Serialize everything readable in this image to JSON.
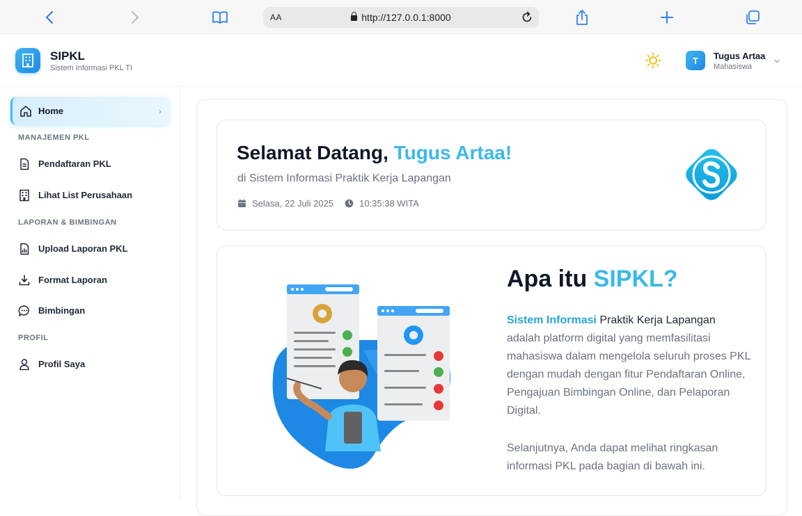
{
  "browser": {
    "aa_label": "AA",
    "url": "http://127.0.0.1:8000"
  },
  "header": {
    "brand": "SIPKL",
    "brand_subtitle": "Sistem Informasi PKL TI",
    "user": {
      "initial": "T",
      "name": "Tugus Artaa",
      "role": "Mahasiswa"
    }
  },
  "sidebar": {
    "home_label": "Home",
    "sections": [
      {
        "title": "MANAJEMEN PKL",
        "items": [
          {
            "label": "Pendaftaran PKL",
            "icon": "document-icon"
          },
          {
            "label": "Lihat List Perusahaan",
            "icon": "building-icon"
          }
        ]
      },
      {
        "title": "LAPORAN & BIMBINGAN",
        "items": [
          {
            "label": "Upload Laporan PKL",
            "icon": "file-upload-icon"
          },
          {
            "label": "Format Laporan",
            "icon": "download-icon"
          },
          {
            "label": "Bimbingan",
            "icon": "chat-icon"
          }
        ]
      },
      {
        "title": "PROFIL",
        "items": [
          {
            "label": "Profil Saya",
            "icon": "user-icon"
          }
        ]
      }
    ]
  },
  "welcome": {
    "greeting": "Selamat Datang, ",
    "name": "Tugus Artaa!",
    "subtitle": "di Sistem Informasi Praktik Kerja Lapangan",
    "date": "Selasa, 22 Juli 2025",
    "time": "10:35:38 WITA"
  },
  "about": {
    "title_prefix": "Apa itu ",
    "title_highlight": "SIPKL?",
    "intro_highlight": "Sistem Informasi",
    "intro_dark": " Praktik Kerja Lapangan",
    "body": " adalah platform digital yang memfasilitasi mahasiswa dalam mengelola seluruh proses PKL dengan mudah dengan fitur Pendaftaran Online, Pengajuan Bimbingan Online, dan Pelaporan Digital.",
    "body2": "Selanjutnya, Anda dapat melihat ringkasan informasi PKL pada bagian di bawah ini."
  },
  "colors": {
    "accent": "#3cb8ea",
    "brand_gradient_start": "#3fb4f0",
    "brand_gradient_end": "#1e88e5",
    "sun": "#f5b800"
  }
}
